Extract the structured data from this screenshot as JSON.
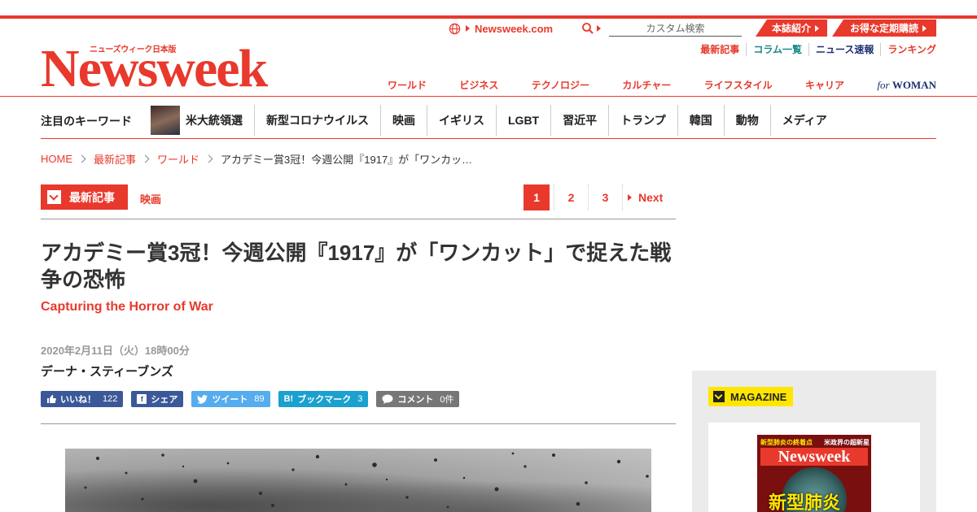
{
  "header": {
    "logo_jp": "ニューズウィーク日本版",
    "logo_word": "Newsweek",
    "global_link": "Newsweek.com",
    "search_placeholder": "カスタム検索",
    "about_button": "本誌紹介",
    "subscribe_button": "お得な定期購読",
    "util_links": [
      {
        "label": "最新記事",
        "color": "#e8392c"
      },
      {
        "label": "コラム一覧",
        "color": "#1a8a86"
      },
      {
        "label": "ニュース速報",
        "color": "#1a2f6e"
      },
      {
        "label": "ランキング",
        "color": "#e8392c"
      }
    ],
    "nav": [
      "ワールド",
      "ビジネス",
      "テクノロジー",
      "カルチャー",
      "ライフスタイル",
      "キャリア"
    ],
    "nav_for": "for",
    "nav_woman": "WOMAN"
  },
  "keywords": {
    "title": "注目のキーワード",
    "items": [
      "米大統領選",
      "新型コロナウイルス",
      "映画",
      "イギリス",
      "LGBT",
      "習近平",
      "トランプ",
      "韓国",
      "動物",
      "メディア"
    ]
  },
  "breadcrumb": [
    "HOME",
    "最新記事",
    "ワールド",
    "アカデミー賞3冠！今週公開『1917』が「ワンカッ…"
  ],
  "section": {
    "tag": "最新記事",
    "sub": "映画"
  },
  "pager": {
    "pages": [
      "1",
      "2",
      "3"
    ],
    "current": "1",
    "next": "Next"
  },
  "article": {
    "title": "アカデミー賞3冠！今週公開『1917』が「ワンカット」で捉えた戦争の恐怖",
    "subtitle": "Capturing the Horror of War",
    "date": "2020年2月11日（火）18時00分",
    "author": "デーナ・スティーブンズ"
  },
  "social": {
    "like_label": "いいね！",
    "like_count": "122",
    "share_label": "シェア",
    "tweet_label": "ツイート",
    "tweet_count": "89",
    "bookmark_label": "ブックマーク",
    "bookmark_count": "3",
    "comment_label": "コメント",
    "comment_count": "0件"
  },
  "sidebar": {
    "magazine_label": "MAGAZINE",
    "cover": {
      "headline_left": "新型肺炎の終着点",
      "headline_right": "米政界の超新星",
      "name": "Newsweek",
      "big_text": "新型肺炎"
    }
  },
  "colors": {
    "brand": "#e8392c",
    "facebook": "#3b5998",
    "twitter": "#55acee",
    "hatena": "#1ba0cf",
    "magazine_tag": "#ffe600"
  }
}
